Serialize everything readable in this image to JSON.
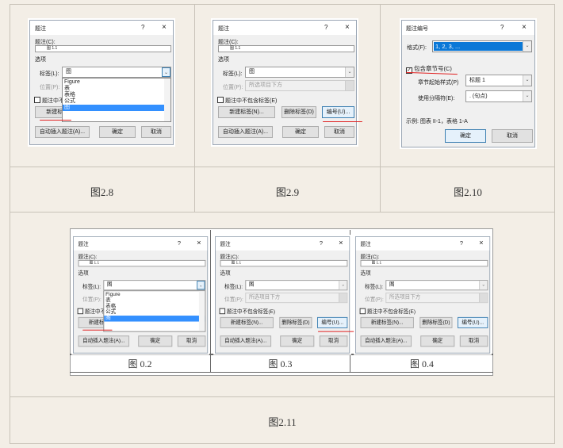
{
  "caption_dialog": {
    "title": "题注",
    "help": "?",
    "close": "×",
    "caption_label": "题注(C):",
    "caption_value": "图 1.1",
    "options_label": "选项",
    "label_label": "标签(L):",
    "label_value": "图",
    "position_label": "位置(P):",
    "position_value": "所选项目下方",
    "exclude_label": "题注中不包含标签(E)",
    "new_label_btn": "新建标签(N)...",
    "delete_label_btn": "删除标签(D)",
    "numbering_btn": "编号(U)...",
    "autocaption_btn": "自动插入题注(A)...",
    "ok_btn": "确定",
    "cancel_btn": "取消",
    "label_options": [
      "Figure",
      "表",
      "表格",
      "公式",
      "图"
    ],
    "selected_option": "图"
  },
  "numbering_dialog": {
    "title": "题注编号",
    "help": "?",
    "close": "×",
    "format_label": "格式(F):",
    "format_value": "1, 2, 3, ...",
    "include_chapter_label": "包含章节号(C)",
    "include_chapter_checked": true,
    "chapter_style_label": "章节起始样式(P)",
    "chapter_style_value": "标题 1",
    "separator_label": "使用分隔符(E):",
    "separator_value": ".    (句点)",
    "example": "示例:  图表 II-1，表格 1-A",
    "ok_btn": "确定",
    "cancel_btn": "取消"
  },
  "figure_captions": [
    "图2.8",
    "图2.9",
    "图2.10",
    "图2.11"
  ],
  "inner_captions": [
    "图  0.2",
    "图  0.3",
    "图  0.4"
  ],
  "colors": {
    "background": "#f3eee6",
    "selection": "#3390ff",
    "annotation": "#e02020"
  }
}
